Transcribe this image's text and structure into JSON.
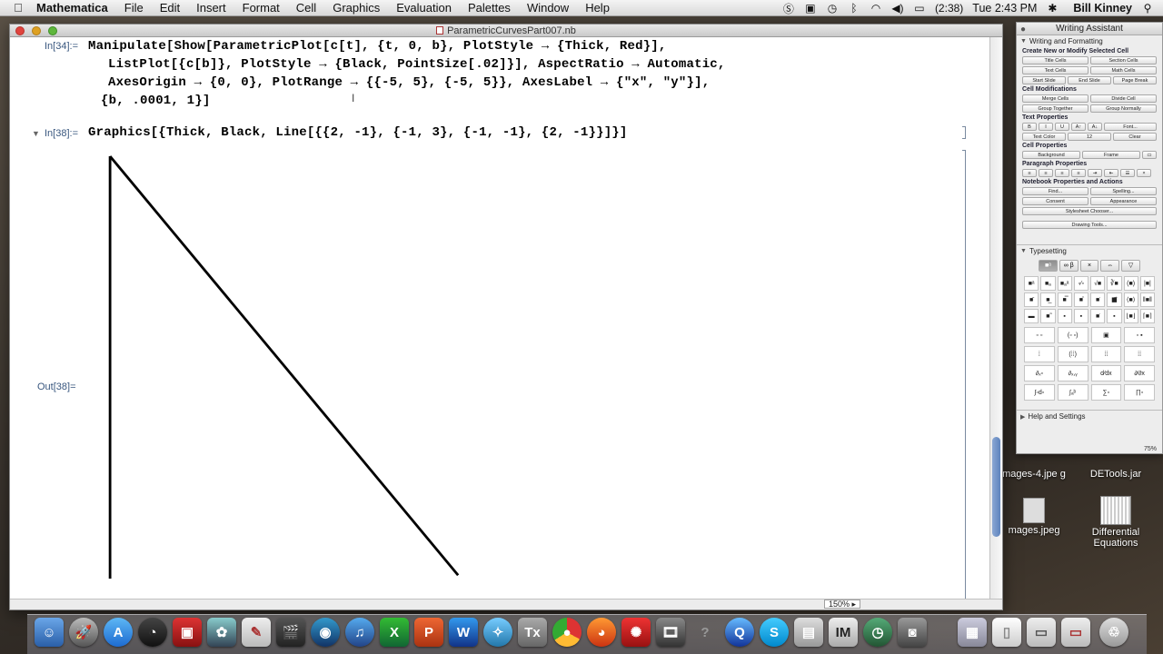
{
  "menubar": {
    "app_name": "Mathematica",
    "menus": [
      "File",
      "Edit",
      "Insert",
      "Format",
      "Cell",
      "Graphics",
      "Evaluation",
      "Palettes",
      "Window",
      "Help"
    ],
    "battery_time": "(2:38)",
    "clock": "Tue 2:43 PM",
    "user": "Bill Kinney"
  },
  "notebook": {
    "title": "ParametricCurvesPart007.nb",
    "in34_label": "In[34]:=",
    "in34_lines": [
      "Manipulate[Show[ParametricPlot[c[t], {t, 0, b}, PlotStyle → {Thick, Red}],",
      "ListPlot[{c[b]}, PlotStyle → {Black, PointSize[.02]}], AspectRatio → Automatic,",
      "AxesOrigin → {0, 0}, PlotRange → {{-5, 5}, {-5, 5}}, AxesLabel → {\"x\", \"y\"}],",
      "{b, .0001, 1}]"
    ],
    "in38_label": "In[38]:=",
    "in38_code": "Graphics[{Thick, Black, Line[{{2, -1}, {-1, 3}, {-1, -1}, {2, -1}}]}]",
    "out38_label": "Out[38]=",
    "zoom": "150%"
  },
  "writing_assistant": {
    "title": "Writing Assistant",
    "section": "Writing and Formatting",
    "create_heading": "Create New or Modify Selected Cell",
    "create_buttons": [
      "Title Cells",
      "Section Cells",
      "Text Cells",
      "Math Cells",
      "Start Slide",
      "End Slide",
      "Page Break"
    ],
    "modifications_heading": "Cell Modifications",
    "modification_buttons": [
      "Merge Cells",
      "Divide Cell",
      "Group Together",
      "Group Normally"
    ],
    "text_properties_heading": "Text Properties",
    "text_buttons": [
      "B",
      "I",
      "U",
      "A↑",
      "A↓",
      "Font..."
    ],
    "text_color": "Text Color",
    "font_size": "12",
    "clear_label": "Clear",
    "cell_properties_heading": "Cell Properties",
    "background_label": "Background",
    "frame_label": "Frame",
    "paragraph_heading": "Paragraph Properties",
    "notebook_heading": "Notebook Properties and Actions",
    "notebook_buttons": [
      "Find...",
      "Spelling...",
      "Consent",
      "Appearance",
      "Stylesheet Chooser...",
      "Drawing Tools..."
    ],
    "typesetting_heading": "Typesetting",
    "typesetting_tabs": [
      "■ᵃ",
      "∞ β",
      "×",
      "⇔",
      "▽"
    ],
    "help_heading": "Help and Settings",
    "zoom": "75%"
  },
  "desktop": {
    "icons": [
      {
        "label": "mages-4.jpe g",
        "name": "images-4-jpeg"
      },
      {
        "label": "DETools.jar",
        "name": "detools-jar"
      },
      {
        "label": "mages.jpeg",
        "name": "images-jpeg"
      },
      {
        "label": "Differential Equations",
        "name": "differential-equations"
      }
    ]
  },
  "dock": {
    "apps": [
      "Finder",
      "Launchpad",
      "App Store",
      "Dashboard",
      "Photo Booth",
      "iPhoto",
      "TextEdit",
      "Final Cut",
      "DVD Player",
      "iTunes",
      "Excel",
      "PowerPoint",
      "Word",
      "Safari",
      "LaTeXiT",
      "Chrome",
      "Firefox",
      "Mathematica",
      "Movie",
      "Help",
      "QuickTime",
      "Skype",
      "Preview",
      "ImageMagick",
      "Time Machine",
      "FaceTime",
      "Stack",
      "Document",
      "Stack2",
      "Stack3",
      "Trash"
    ]
  }
}
